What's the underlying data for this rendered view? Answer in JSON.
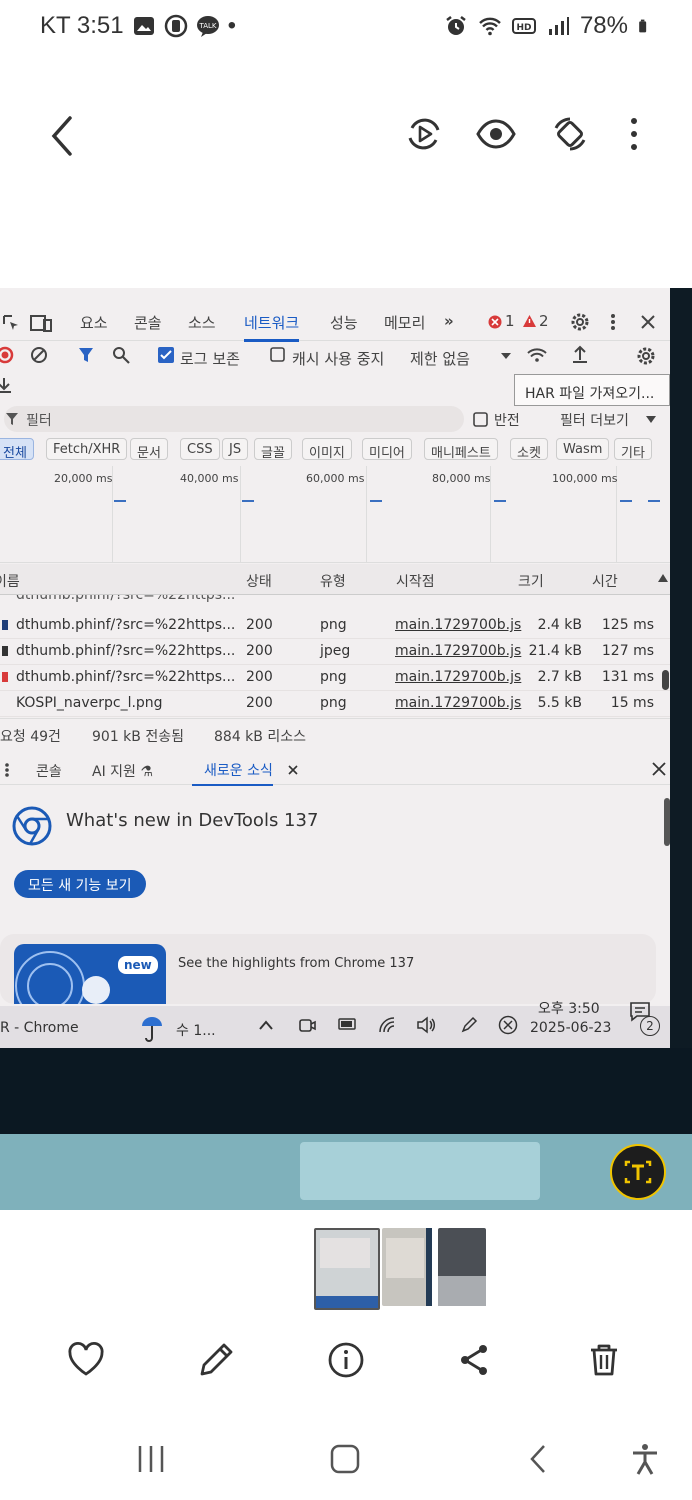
{
  "status_bar": {
    "carrier_time": "KT 3:51",
    "dot": "•",
    "battery": "78%"
  },
  "viewer": {
    "thumbnails": 3
  },
  "devtools": {
    "panel_tabs": [
      "요소",
      "콘솔",
      "소스",
      "네트워크",
      "성능",
      "메모리"
    ],
    "more_tabs": "»",
    "error_count": "1",
    "warning_count": "2",
    "toolbar": {
      "preserve_log": "로그 보존",
      "disable_cache": "캐시 사용 중지",
      "throttle": "제한 없음"
    },
    "tooltip": "HAR 파일 가져오기...",
    "filter": {
      "placeholder": "필터",
      "invert": "반전",
      "more_filters": "필터 더보기"
    },
    "type_chips": [
      "전체",
      "Fetch/XHR",
      "문서",
      "CSS",
      "JS",
      "글꼴",
      "이미지",
      "미디어",
      "매니페스트",
      "소켓",
      "Wasm",
      "기타"
    ],
    "timeline_ticks": [
      "20,000 ms",
      "40,000 ms",
      "60,000 ms",
      "80,000 ms",
      "100,000 ms"
    ],
    "columns": [
      "이름",
      "상태",
      "유형",
      "시작점",
      "크기",
      "시간"
    ],
    "rows": [
      {
        "name": "dthumb.phinf/?src=%22https...",
        "status": "200",
        "type": "png",
        "initiator": "main.1729700b.js",
        "size": "2.4 kB",
        "time": "125 ms",
        "mark": "#1f3f7a"
      },
      {
        "name": "dthumb.phinf/?src=%22https...",
        "status": "200",
        "type": "jpeg",
        "initiator": "main.1729700b.js",
        "size": "21.4 kB",
        "time": "127 ms",
        "mark": "#333333"
      },
      {
        "name": "dthumb.phinf/?src=%22https...",
        "status": "200",
        "type": "png",
        "initiator": "main.1729700b.js",
        "size": "2.7 kB",
        "time": "131 ms",
        "mark": "#d83a3a"
      },
      {
        "name": "KOSPI_naverpc_l.png",
        "status": "200",
        "type": "png",
        "initiator": "main.1729700b.js",
        "size": "5.5 kB",
        "time": "15 ms",
        "mark": ""
      }
    ],
    "summary": {
      "requests": "요청 49건",
      "transferred": "901 kB 전송됨",
      "resources": "884 kB 리소스"
    },
    "drawer_tabs": {
      "console": "콘솔",
      "ai": "AI 지원 ⚗",
      "whats_new": "새로운 소식"
    },
    "whats_new": {
      "title": "What's new in DevTools 137",
      "button": "모든 새 기능 보기",
      "badge": "new",
      "highlight": "See the highlights from Chrome 137"
    },
    "taskbar": {
      "app": "R - Chrome",
      "weather": "수 1...",
      "time": "오후 3:50",
      "date": "2025-06-23",
      "notifications": "2"
    }
  },
  "colors": {
    "accent": "#1a5bc4",
    "button_blue": "#1b5ab6",
    "error": "#d83a3a"
  }
}
